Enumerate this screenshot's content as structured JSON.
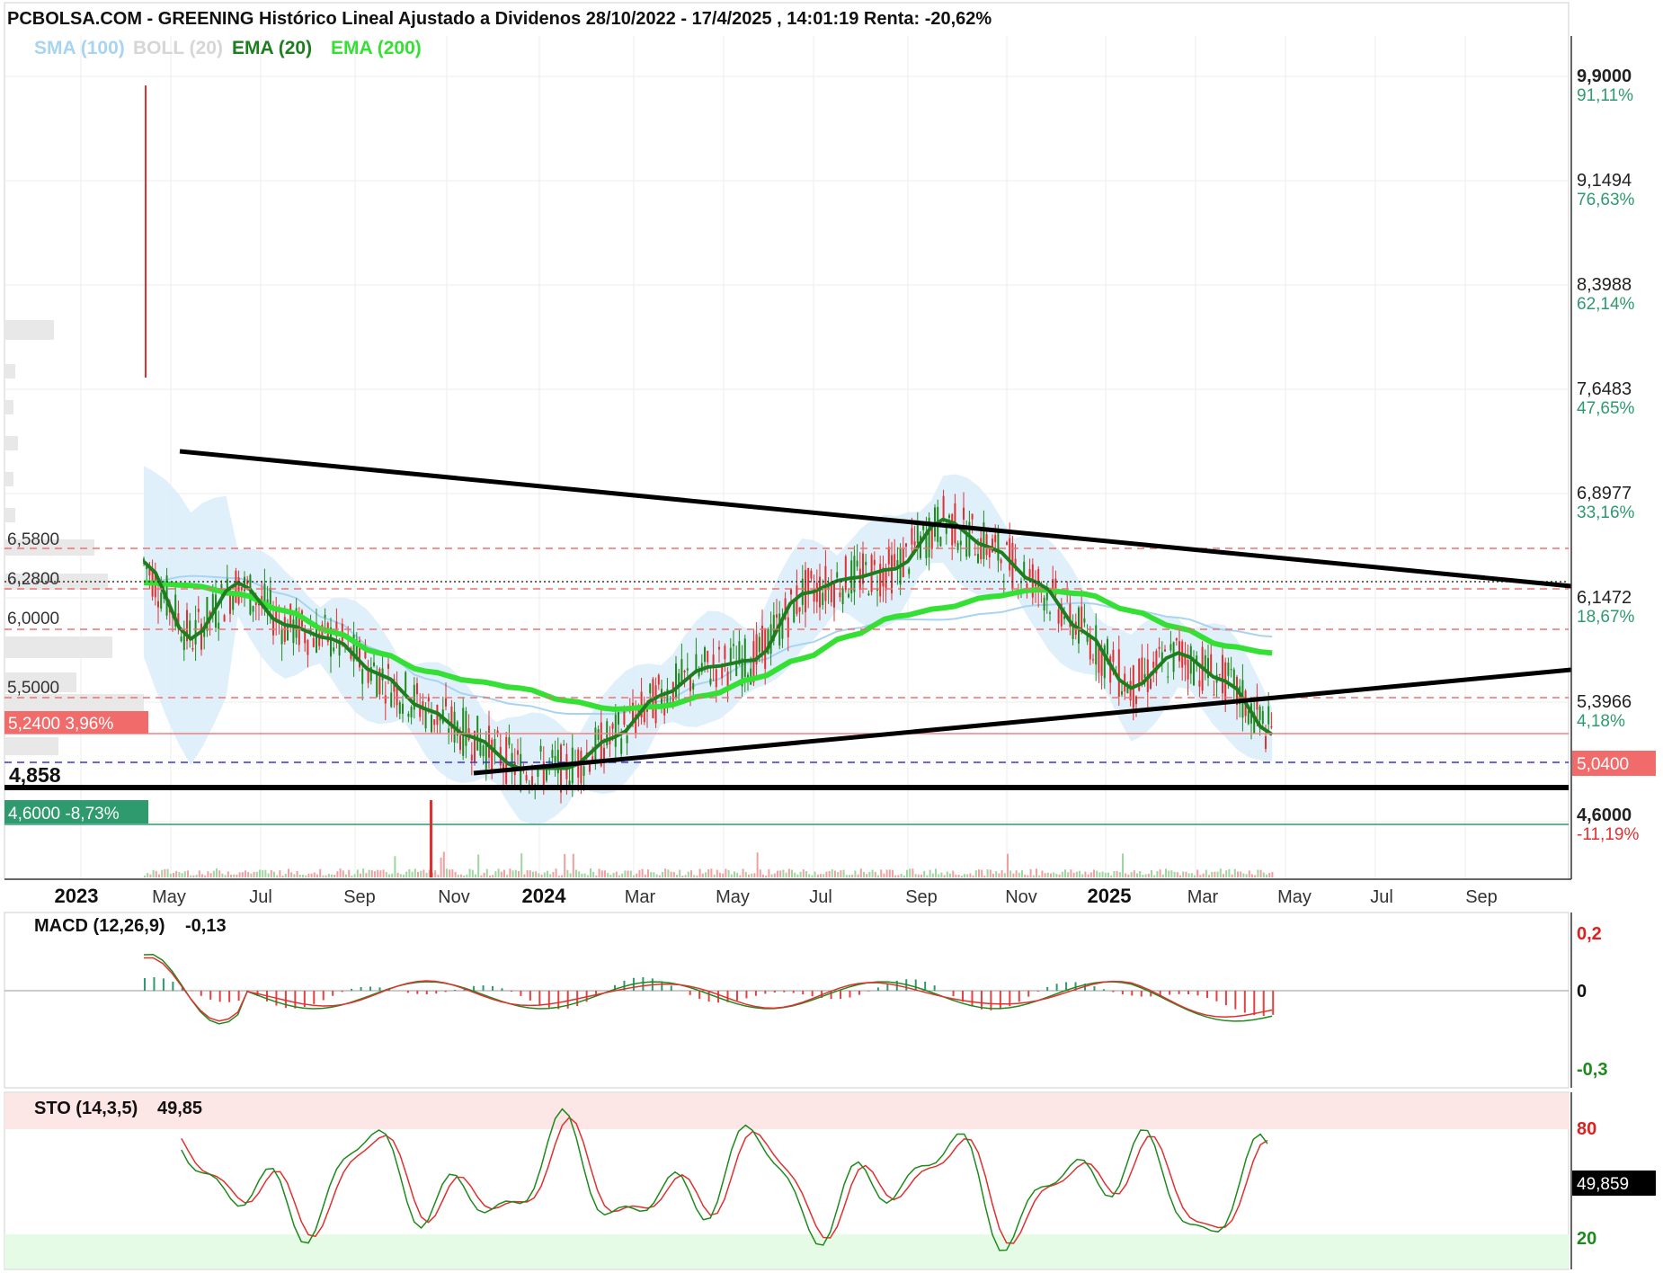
{
  "header": {
    "title": "PCBOLSA.COM - GREENING Histórico Lineal Ajustado a Dividenos 28/10/2022 - 17/4/2025 , 14:01:19 Renta: -20,62%"
  },
  "legend": [
    {
      "label": "SMA (100)",
      "color": "#a8d4f2"
    },
    {
      "label": "BOLL (20)",
      "color": "#d6d6d6"
    },
    {
      "label": "EMA (20)",
      "color": "#1e7d1e"
    },
    {
      "label": "EMA (200)",
      "color": "#34e034"
    }
  ],
  "right_axis": [
    {
      "price": "9,9000",
      "pct": "91,11%",
      "pct_color": "#2e9a6e"
    },
    {
      "price": "9,1494",
      "pct": "76,63%",
      "pct_color": "#2e9a6e"
    },
    {
      "price": "8,3988",
      "pct": "62,14%",
      "pct_color": "#2e9a6e"
    },
    {
      "price": "7,6483",
      "pct": "47,65%",
      "pct_color": "#2e9a6e"
    },
    {
      "price": "6,8977",
      "pct": "33,16%",
      "pct_color": "#2e9a6e"
    },
    {
      "price": "6,1472",
      "pct": "18,67%",
      "pct_color": "#2e9a6e"
    },
    {
      "price": "5,3966",
      "pct": "4,18%",
      "pct_color": "#2e9a6e"
    },
    {
      "price": "4,6000",
      "pct": "-11,19%",
      "pct_color": "#e23030"
    }
  ],
  "current_price": "5,0400",
  "left_levels": [
    "6,5800",
    "6,2800",
    "6,0000",
    "5,5000"
  ],
  "tags": {
    "high": "5,2400  3,96%",
    "support": "4,858",
    "low": "4,6000  -8,73%"
  },
  "x_axis": [
    {
      "label": "2023",
      "bold": true
    },
    {
      "label": "May",
      "bold": false
    },
    {
      "label": "Jul",
      "bold": false
    },
    {
      "label": "Sep",
      "bold": false
    },
    {
      "label": "Nov",
      "bold": false
    },
    {
      "label": "2024",
      "bold": true
    },
    {
      "label": "Mar",
      "bold": false
    },
    {
      "label": "May",
      "bold": false
    },
    {
      "label": "Jul",
      "bold": false
    },
    {
      "label": "Sep",
      "bold": false
    },
    {
      "label": "Nov",
      "bold": false
    },
    {
      "label": "2025",
      "bold": true
    },
    {
      "label": "Mar",
      "bold": false
    },
    {
      "label": "May",
      "bold": false
    },
    {
      "label": "Jul",
      "bold": false
    },
    {
      "label": "Sep",
      "bold": false
    }
  ],
  "macd": {
    "label": "MACD (12,26,9)",
    "value": "-0,13",
    "ticks": [
      {
        "label": "0,2",
        "color": "#e02020"
      },
      {
        "label": "0",
        "color": "#111111"
      },
      {
        "label": "-0,3",
        "color": "#1e8a1e"
      }
    ]
  },
  "sto": {
    "label": "STO (14,3,5)",
    "value": "49,85",
    "current": "49,859",
    "ticks": [
      {
        "label": "80",
        "color": "#e02020"
      },
      {
        "label": "20",
        "color": "#1e8a1e"
      }
    ]
  },
  "chart_data": {
    "type": "line",
    "title": "PCBOLSA.COM - GREENING Histórico Lineal Ajustado a Dividenos 28/10/2022 - 17/4/2025 , 14:01:19 Renta: -20,62%",
    "x": [
      "2023-04",
      "2023-05",
      "2023-06",
      "2023-07",
      "2023-08",
      "2023-09",
      "2023-10",
      "2023-11",
      "2023-12",
      "2024-01",
      "2024-02",
      "2024-03",
      "2024-04",
      "2024-05",
      "2024-06",
      "2024-07",
      "2024-08",
      "2024-09",
      "2024-10",
      "2024-11",
      "2024-12",
      "2025-01",
      "2025-02",
      "2025-03",
      "2025-04"
    ],
    "series": [
      {
        "name": "EMA (20)",
        "values": [
          6.45,
          5.9,
          6.3,
          6.0,
          5.9,
          5.65,
          5.4,
          5.2,
          4.98,
          4.98,
          5.2,
          5.5,
          5.7,
          5.75,
          6.22,
          6.33,
          6.4,
          6.75,
          6.55,
          6.3,
          5.95,
          5.55,
          5.8,
          5.6,
          5.22
        ]
      },
      {
        "name": "EMA (200)",
        "values": [
          6.3,
          6.28,
          6.22,
          6.1,
          5.95,
          5.8,
          5.67,
          5.6,
          5.55,
          5.46,
          5.4,
          5.42,
          5.5,
          5.62,
          5.76,
          5.92,
          6.06,
          6.12,
          6.2,
          6.25,
          6.22,
          6.1,
          5.98,
          5.85,
          5.8
        ]
      }
    ],
    "ylim": [
      4.6,
      9.9
    ],
    "horizontal_levels": [
      6.58,
      6.28,
      6.0,
      5.5,
      5.24,
      5.04,
      4.858,
      4.6
    ],
    "macd_ylim": [
      -0.3,
      0.2
    ],
    "sto_levels": [
      80,
      20
    ],
    "grid": true,
    "legend_position": "top-left"
  }
}
